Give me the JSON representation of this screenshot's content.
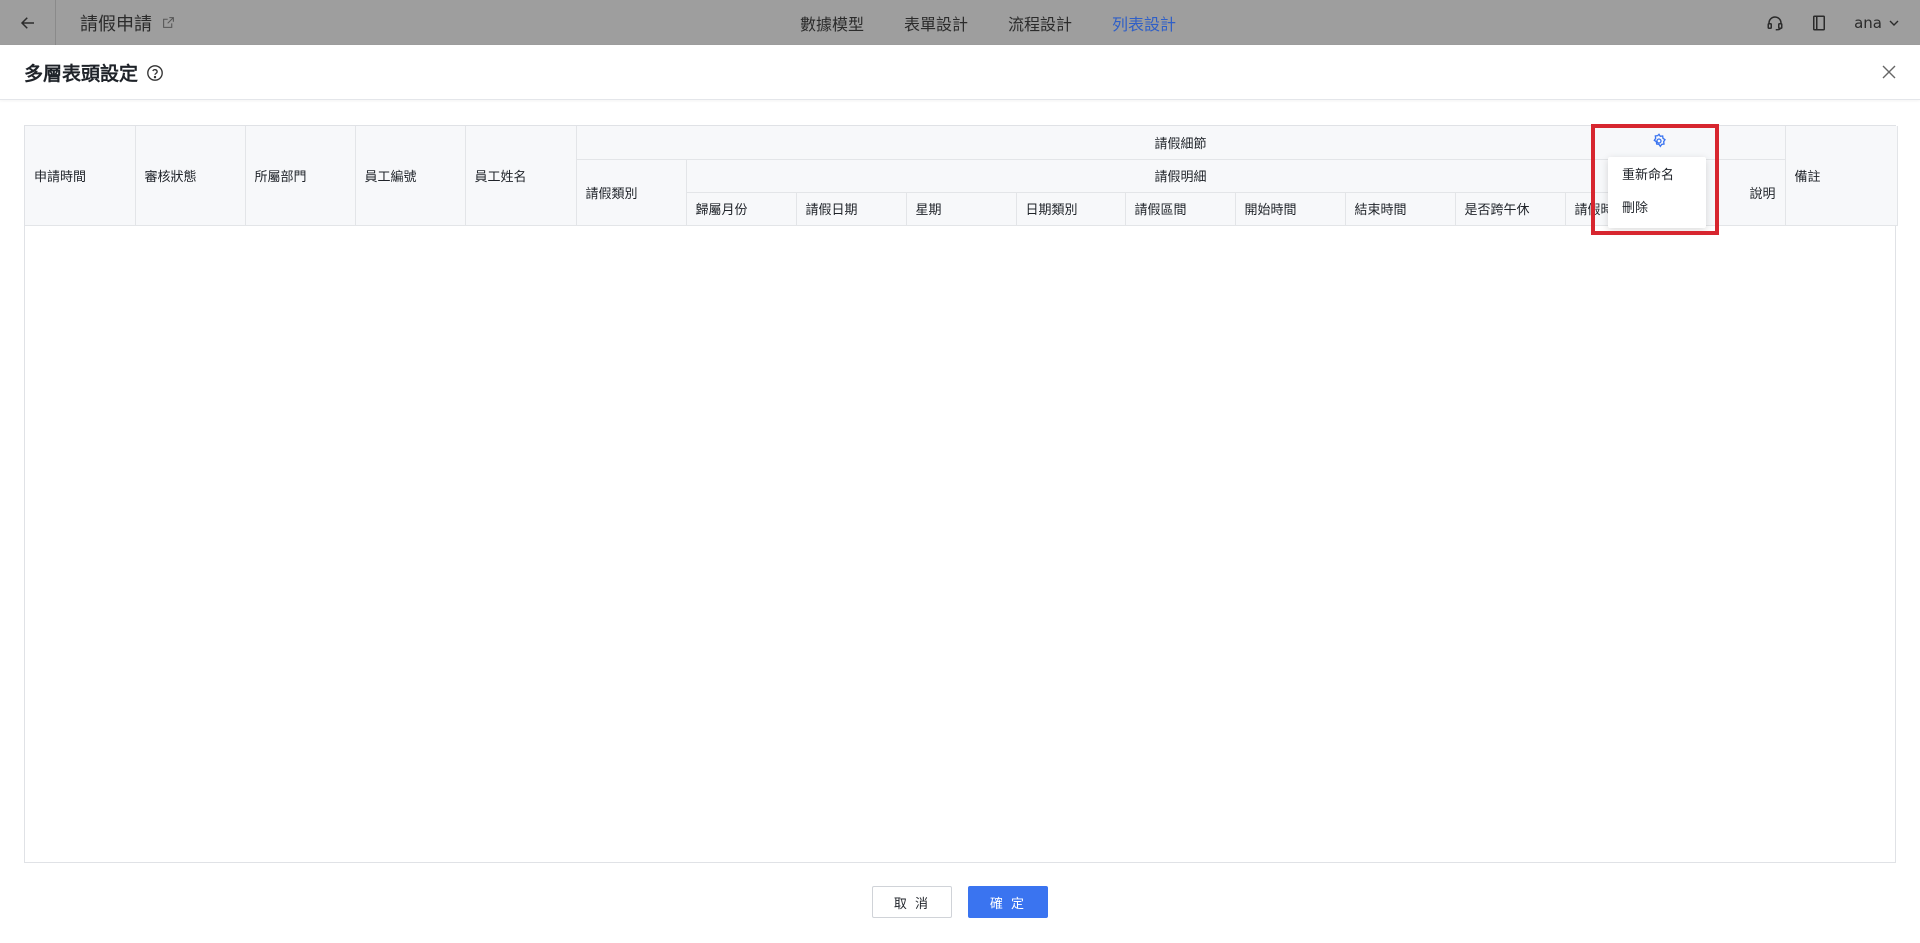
{
  "topbar": {
    "app_title": "請假申請",
    "tabs": [
      {
        "label": "數據模型",
        "active": false
      },
      {
        "label": "表單設計",
        "active": false
      },
      {
        "label": "流程設計",
        "active": false
      },
      {
        "label": "列表設計",
        "active": true
      }
    ],
    "user": "ana"
  },
  "modal": {
    "title": "多層表頭設定"
  },
  "table": {
    "row1": {
      "col_apply_time": "申請時間",
      "col_review_status": "審核狀態",
      "col_department": "所屬部門",
      "col_employee_no": "員工編號",
      "col_employee_name": "員工姓名",
      "group_leave_detail": "請假細節",
      "col_leave_note_partial": "說明",
      "col_remark": "備註"
    },
    "row2": {
      "col_leave_type": "請假類別",
      "group_leave_items": "請假明細"
    },
    "row3": {
      "col_month": "歸屬月份",
      "col_leave_date": "請假日期",
      "col_weekday": "星期",
      "col_date_type": "日期類別",
      "col_leave_period": "請假區間",
      "col_start_time": "開始時間",
      "col_end_time": "結束時間",
      "col_cross_lunch": "是否跨午休",
      "col_leave_hours_partial": "請假時"
    }
  },
  "context_menu": {
    "items": [
      "重新命名",
      "刪除"
    ]
  },
  "footer": {
    "cancel_label": "取 消",
    "ok_label": "確 定"
  },
  "colors": {
    "accent": "#3a74f0",
    "active_tab": "#2f5fc7",
    "highlight": "#d7262f"
  }
}
